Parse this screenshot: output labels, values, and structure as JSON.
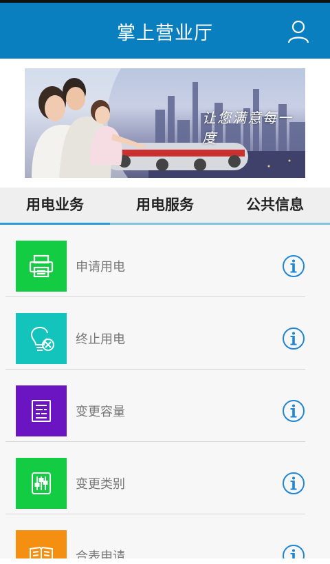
{
  "header": {
    "title": "掌上营业厅",
    "user_icon": "user-icon"
  },
  "banner": {
    "slogan": "让您满意每一度"
  },
  "tabs": [
    {
      "label": "用电业务",
      "active": true
    },
    {
      "label": "用电服务",
      "active": false
    },
    {
      "label": "公共信息",
      "active": false
    }
  ],
  "services": [
    {
      "label": "申请用电",
      "icon": "printer-icon",
      "color": "#14cc43"
    },
    {
      "label": "终止用电",
      "icon": "bulb-cancel-icon",
      "color": "#12c4bc"
    },
    {
      "label": "变更容量",
      "icon": "form-list-icon",
      "color": "#6b14c2"
    },
    {
      "label": "变更类别",
      "icon": "sliders-icon",
      "color": "#14cc43"
    },
    {
      "label": "合表申请",
      "icon": "book-icon",
      "color": "#f58f12"
    }
  ],
  "colors": {
    "header": "#0a7fc0",
    "accent": "#2a9ad8",
    "info": "#1e86d6"
  }
}
